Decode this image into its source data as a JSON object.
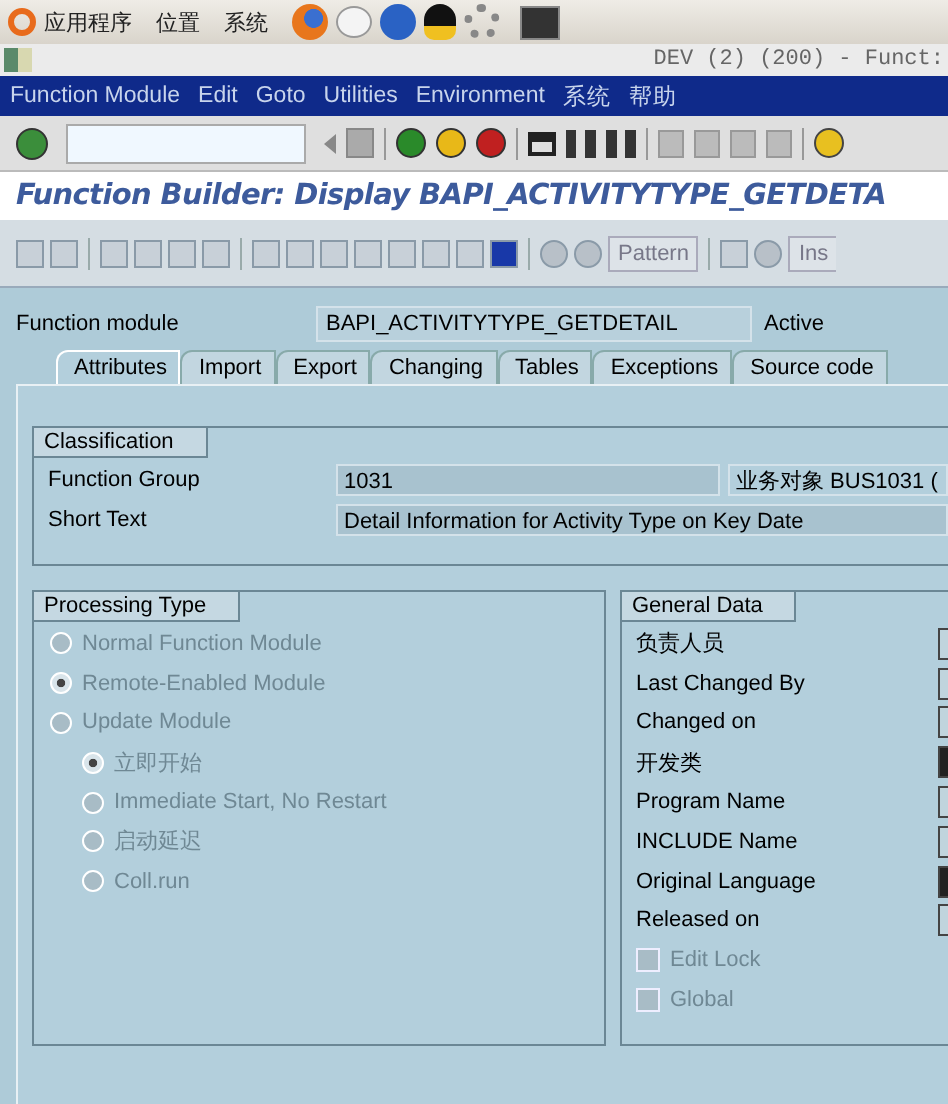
{
  "top_panel": {
    "menus": [
      "应用程序",
      "位置",
      "系统"
    ]
  },
  "window": {
    "title": "DEV (2) (200) - Funct:"
  },
  "menu_bar": [
    "Function Module",
    "Edit",
    "Goto",
    "Utilities",
    "Environment",
    "系统",
    "帮助"
  ],
  "screen_title": "Function Builder: Display BAPI_ACTIVITYTYPE_GETDETA",
  "app_toolbar": {
    "pattern_button": "Pattern",
    "insert_button": "Ins"
  },
  "header": {
    "label": "Function module",
    "value": "BAPI_ACTIVITYTYPE_GETDETAIL",
    "status": "Active"
  },
  "tabs": [
    {
      "label": "Attributes",
      "selected": true
    },
    {
      "label": "Import",
      "selected": false
    },
    {
      "label": "Export",
      "selected": false
    },
    {
      "label": "Changing",
      "selected": false
    },
    {
      "label": "Tables",
      "selected": false
    },
    {
      "label": "Exceptions",
      "selected": false
    },
    {
      "label": "Source code",
      "selected": false
    }
  ],
  "classification": {
    "title": "Classification",
    "function_group": {
      "label": "Function Group",
      "value": "1031",
      "description": "业务对象 BUS1031 ("
    },
    "short_text": {
      "label": "Short Text",
      "value": "Detail Information for Activity Type on Key Date"
    }
  },
  "processing_type": {
    "title": "Processing Type",
    "options": [
      {
        "label": "Normal Function Module",
        "selected": false,
        "disabled": true
      },
      {
        "label": "Remote-Enabled Module",
        "selected": true,
        "disabled": true
      },
      {
        "label": "Update Module",
        "selected": false,
        "disabled": true,
        "children": [
          {
            "label": "立即开始",
            "selected": true,
            "disabled": true
          },
          {
            "label": "Immediate Start, No Restart",
            "selected": false,
            "disabled": true
          },
          {
            "label": "启动延迟",
            "selected": false,
            "disabled": true
          },
          {
            "label": "Coll.run",
            "selected": false,
            "disabled": true
          }
        ]
      }
    ]
  },
  "general_data": {
    "title": "General Data",
    "fields": [
      {
        "label": "负责人员",
        "dark": false
      },
      {
        "label": "Last Changed By",
        "dark": false
      },
      {
        "label": "Changed on",
        "dark": false
      },
      {
        "label": "开发类",
        "dark": true
      },
      {
        "label": "Program Name",
        "dark": false
      },
      {
        "label": "INCLUDE Name",
        "dark": false
      },
      {
        "label": "Original Language",
        "dark": true
      },
      {
        "label": "Released on",
        "dark": false
      }
    ],
    "checkboxes": [
      {
        "label": "Edit Lock",
        "checked": false,
        "disabled": true
      },
      {
        "label": "Global",
        "checked": false,
        "disabled": true
      }
    ]
  }
}
